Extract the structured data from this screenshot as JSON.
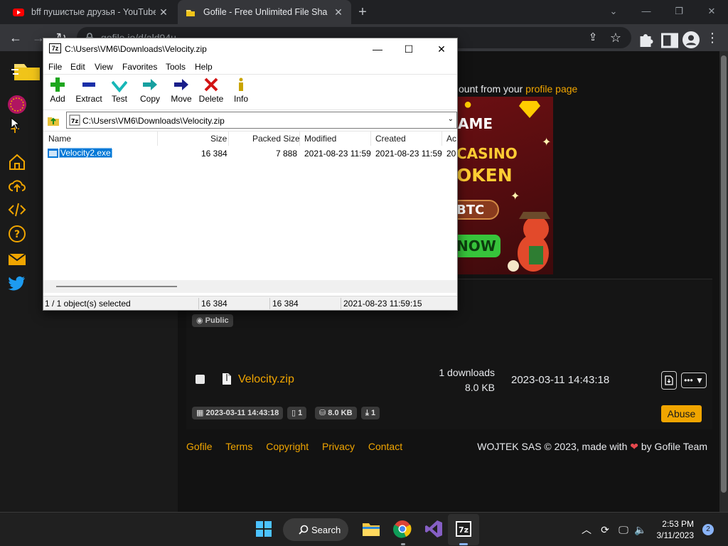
{
  "browser": {
    "tabs": [
      {
        "title": "bff пушистые друзья - YouTube",
        "active": false
      },
      {
        "title": "Gofile - Free Unlimited File Sharing",
        "active": true
      }
    ],
    "url": "gofile.io/d/ald94u"
  },
  "page": {
    "profile_text": "ount from your ",
    "profile_link": "profile page",
    "ad": {
      "line1": "AME",
      "line2": "CASINO",
      "line3": "OKEN",
      "line4": "BTC",
      "line5": "NOW"
    },
    "public_badge": "Public",
    "file": {
      "name": "Velocity.zip",
      "downloads": "1 downloads",
      "size": "8.0 KB",
      "date": "2023-03-11 14:43:18"
    },
    "chips": {
      "date": "2023-03-11 14:43:18",
      "count": "1",
      "size": "8.0 KB",
      "downloads": "1"
    },
    "abuse_label": "Abuse",
    "footer_links": [
      "Gofile",
      "Terms",
      "Copyright",
      "Privacy",
      "Contact"
    ],
    "footer_right_prefix": "WOJTEK SAS © 2023, made with ",
    "footer_right_suffix": " by Gofile Team"
  },
  "zip": {
    "title": "C:\\Users\\VM6\\Downloads\\Velocity.zip",
    "logo": "7z",
    "menu": [
      "File",
      "Edit",
      "View",
      "Favorites",
      "Tools",
      "Help"
    ],
    "tools": [
      "Add",
      "Extract",
      "Test",
      "Copy",
      "Move",
      "Delete",
      "Info"
    ],
    "path": "C:\\Users\\VM6\\Downloads\\Velocity.zip",
    "columns": [
      "Name",
      "Size",
      "Packed Size",
      "Modified",
      "Created",
      "Ac"
    ],
    "rows": [
      {
        "name": "Velocity2.exe",
        "size": "16 384",
        "packed": "7 888",
        "modified": "2021-08-23 11:59",
        "created": "2021-08-23 11:59",
        "accessed": "20"
      }
    ],
    "status": {
      "selected": "1 / 1 object(s) selected",
      "size": "16 384",
      "packed": "16 384",
      "modified": "2021-08-23 11:59:15"
    }
  },
  "taskbar": {
    "search_label": "Search",
    "time": "2:53 PM",
    "date": "3/11/2023",
    "notifications": "2",
    "icons": [
      "windows-start-icon",
      "search-icon",
      "file-explorer-icon",
      "chrome-icon",
      "visual-studio-icon",
      "7zip-icon"
    ]
  },
  "colors": {
    "accent": "#f0a500",
    "selection": "#0078d7"
  }
}
